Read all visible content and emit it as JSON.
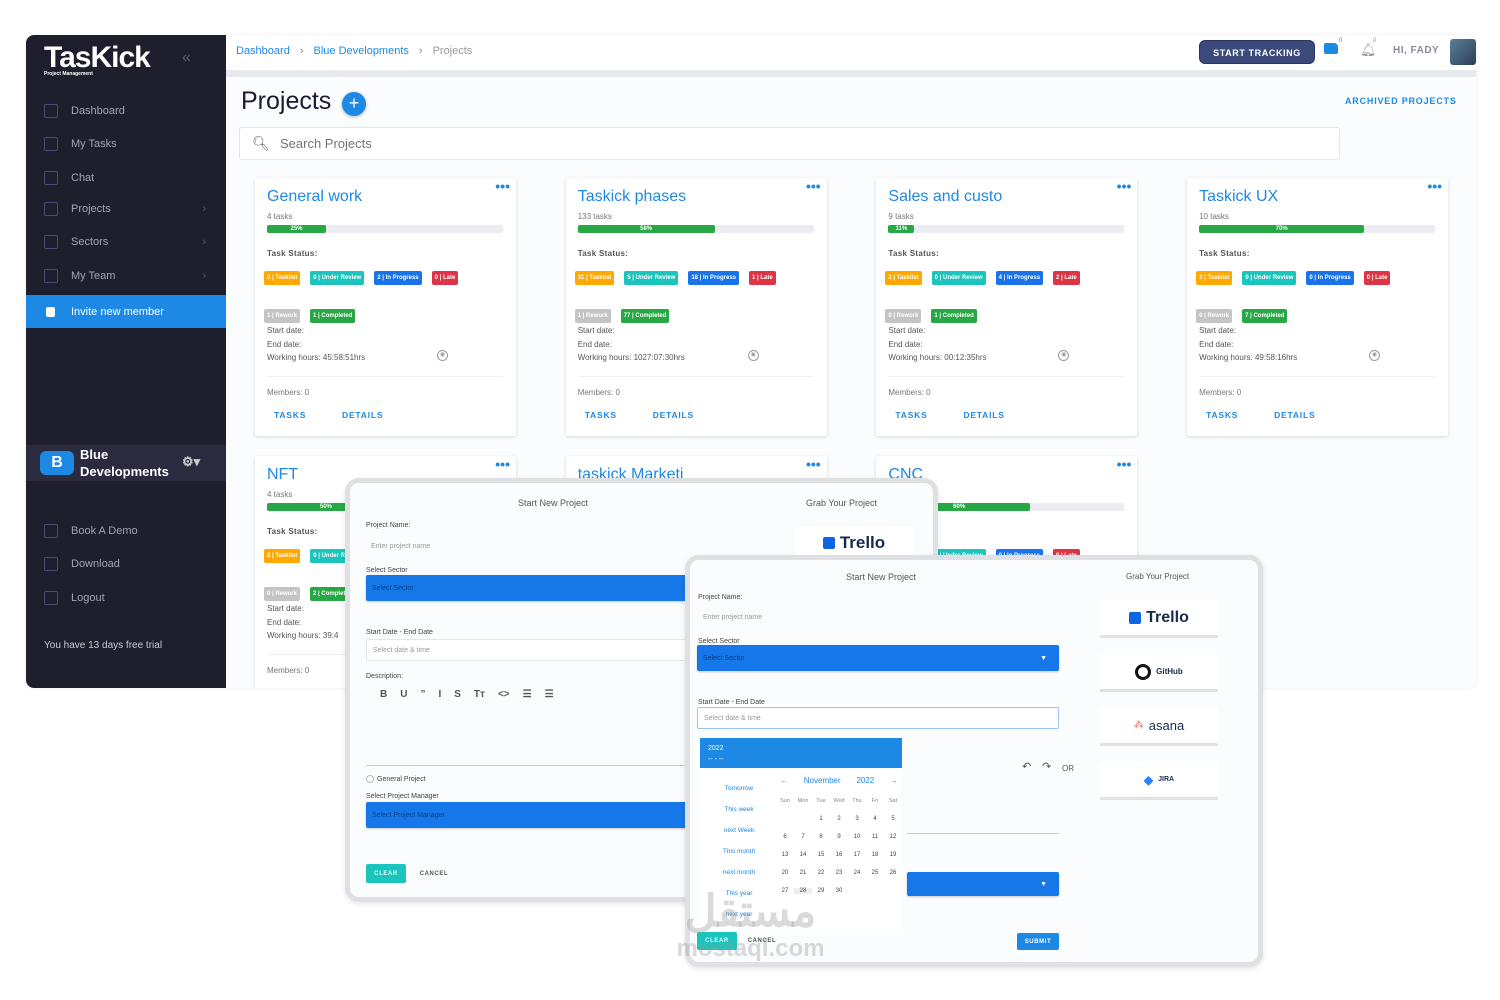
{
  "sidebar": {
    "logo": "TasKick",
    "logo_sub": "Project Management",
    "items": [
      {
        "label": "Dashboard",
        "icon": "home-icon"
      },
      {
        "label": "My Tasks",
        "icon": "clipboard-icon"
      },
      {
        "label": "Chat",
        "icon": "chat-icon"
      },
      {
        "label": "Projects",
        "icon": "projects-icon",
        "chevron": true
      },
      {
        "label": "Sectors",
        "icon": "layers-icon",
        "chevron": true
      },
      {
        "label": "My Team",
        "icon": "team-icon",
        "chevron": true
      },
      {
        "label": "Invite new member",
        "icon": "invite-icon",
        "active": true
      }
    ],
    "sector": {
      "name_line1": "Blue",
      "name_line2": "Developments",
      "logo_letter": "B"
    },
    "bottom_items": [
      {
        "label": "Book A Demo",
        "icon": "calendar-icon"
      },
      {
        "label": "Download",
        "icon": "download-icon"
      },
      {
        "label": "Logout",
        "icon": "logout-icon"
      }
    ],
    "trial_text": "You have 13 days free trial"
  },
  "header": {
    "breadcrumb": [
      "Dashboard",
      "Blue Developments",
      "Projects"
    ],
    "start_tracking": "START TRACKING",
    "greeting": "HI, FADY",
    "chat_badge": "0",
    "notif_badge": "0"
  },
  "main": {
    "title": "Projects",
    "archived": "ARCHIVED PROJECTS",
    "search_placeholder": "Search Projects",
    "labels": {
      "task_status": "Task Status:",
      "start": "Start date:",
      "end": "End date:",
      "tasks_link": "TASKS",
      "details_link": "DETAILS"
    },
    "status_colors": {
      "Tasklist": "#ffa800",
      "Under Review": "#1bc5bd",
      "In Progress": "#1a73e8",
      "Late": "#dc3545",
      "Rework": "#c4c4c4",
      "Completed": "#28a745"
    },
    "projects": [
      {
        "title": "General work",
        "tasks": "4 tasks",
        "progress": 25,
        "progress_label": "25%",
        "badges": [
          "0 | Tasklist",
          "0 | Under Review",
          "2 | In Progress",
          "0 | Late",
          "1 | Rework",
          "1 | Completed"
        ],
        "working_hours": "Working hours: 45:58:51hrs",
        "members": "Members: 0"
      },
      {
        "title": "Taskick phases",
        "tasks": "133 tasks",
        "progress": 58,
        "progress_label": "58%",
        "badges": [
          "31 | Tasklist",
          "5 | Under Review",
          "18 | In Progress",
          "1 | Late",
          "1 | Rework",
          "77 | Completed"
        ],
        "working_hours": "Working hours: 1027:07:30hrs",
        "members": "Members: 0"
      },
      {
        "title": "Sales and custo",
        "tasks": "9 tasks",
        "progress": 11,
        "progress_label": "11%",
        "badges": [
          "2 | Tasklist",
          "0 | Under Review",
          "4 | In Progress",
          "2 | Late",
          "0 | Rework",
          "1 | Completed"
        ],
        "working_hours": "Working hours: 00:12:35hrs",
        "members": "Members: 0"
      },
      {
        "title": "Taskick UX",
        "tasks": "10 tasks",
        "progress": 70,
        "progress_label": "70%",
        "badges": [
          "3 | Tasklist",
          "0 | Under Review",
          "0 | In Progress",
          "0 | Late",
          "0 | Rework",
          "7 | Completed"
        ],
        "working_hours": "Working hours: 49:58:16hrs",
        "members": "Members: 0"
      },
      {
        "title": "NFT",
        "tasks": "4 tasks",
        "progress": 50,
        "progress_label": "50%",
        "badges": [
          "2 | Tasklist",
          "0 | Under Review",
          "",
          "",
          "0 | Rework",
          "2 | Completed"
        ],
        "working_hours": "Working hours: 39:4",
        "members": "Members: 0"
      },
      {
        "title": "taskick Marketi"
      },
      {
        "title": "CNC",
        "progress": 60,
        "progress_label": "60%",
        "badges": [
          "",
          "0 | Under Review",
          "0 | In Progress",
          "0 | Late"
        ]
      }
    ]
  },
  "modal1": {
    "title": "Start New Project",
    "grab": "Grab Your Project",
    "project_name_label": "Project Name:",
    "project_name_placeholder": "Enter project name",
    "sector_label": "Select Sector",
    "sector_value": "Select Sector",
    "date_label": "Start Date - End Date",
    "date_placeholder": "Select date & time",
    "description_label": "Description:",
    "toolbar": [
      "B",
      "U",
      "”",
      "I",
      "S",
      "Tт",
      "<>",
      "☰",
      "☰"
    ],
    "general_project": "General Project",
    "manager_label": "Select Project Manager",
    "manager_value": "Select Project Manager",
    "clear": "CLEAR",
    "cancel": "CANCEL",
    "trello": "Trello"
  },
  "modal2": {
    "title": "Start New Project",
    "grab": "Grab Your Project",
    "project_name_label": "Project Name:",
    "project_name_placeholder": "Enter project name",
    "sector_label": "Select Sector",
    "sector_value": "Select Sector",
    "date_label": "Start Date - End Date",
    "date_placeholder": "Select date & time",
    "or": "OR",
    "clear": "CLEAR",
    "cancel": "CANCEL",
    "submit": "SUBMIT",
    "services": [
      "Trello",
      "GitHub",
      "asana",
      "JIRA"
    ],
    "picker": {
      "year": "2022",
      "range": "-- - --",
      "quick": [
        "Tomorrow",
        "This week",
        "next Week",
        "This month",
        "next month",
        "This year",
        "next year"
      ],
      "month": "November",
      "month_year": "2022",
      "weekdays": [
        "Sun",
        "Mon",
        "Tue",
        "Wed",
        "Thu",
        "Fri",
        "Sat"
      ],
      "first_weekday": 2,
      "days": 30,
      "highlighted_day": 28
    }
  },
  "watermark": {
    "arabic": "مستقل",
    "latin": "mostaql.com"
  }
}
